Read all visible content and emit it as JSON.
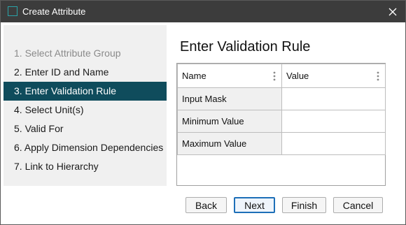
{
  "window": {
    "title": "Create Attribute",
    "accent_color": "#0f4c5c"
  },
  "steps": [
    {
      "label": "1. Select Attribute Group",
      "state": "disabled"
    },
    {
      "label": "2. Enter ID and Name",
      "state": "normal"
    },
    {
      "label": "3. Enter Validation Rule",
      "state": "active"
    },
    {
      "label": "4. Select Unit(s)",
      "state": "normal"
    },
    {
      "label": "5. Valid For",
      "state": "normal"
    },
    {
      "label": "6. Apply Dimension Dependencies",
      "state": "normal"
    },
    {
      "label": "7. Link to Hierarchy",
      "state": "normal"
    }
  ],
  "main": {
    "heading": "Enter Validation Rule",
    "table": {
      "columns": [
        "Name",
        "Value"
      ],
      "rows": [
        {
          "name": "Input Mask",
          "value": ""
        },
        {
          "name": "Minimum Value",
          "value": ""
        },
        {
          "name": "Maximum Value",
          "value": ""
        }
      ]
    }
  },
  "footer": {
    "back_label": "Back",
    "next_label": "Next",
    "finish_label": "Finish",
    "cancel_label": "Cancel"
  }
}
